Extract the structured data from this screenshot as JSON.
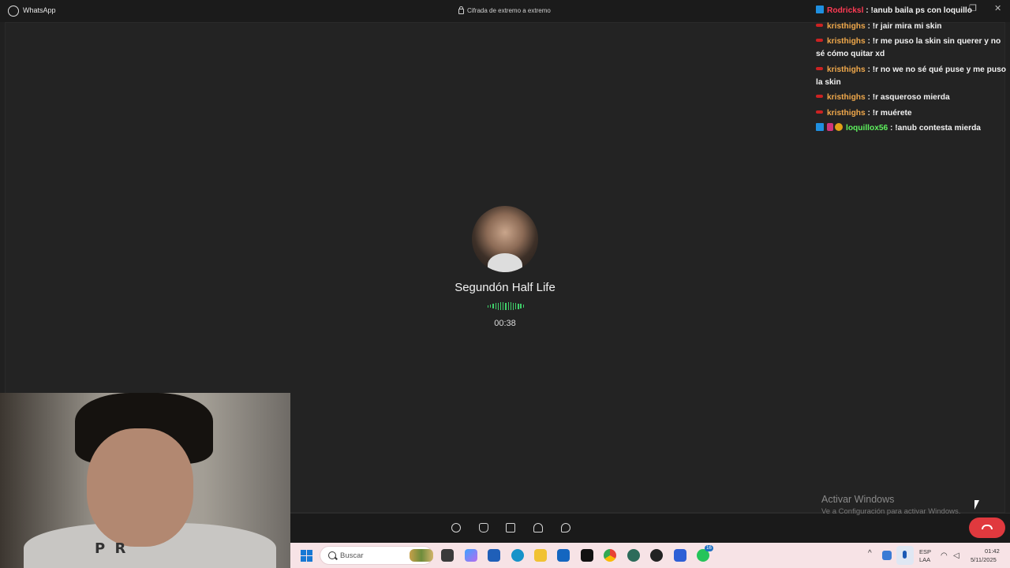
{
  "window": {
    "app_name": "WhatsApp",
    "encryption_label": "Cifrada de extremo a extremo"
  },
  "call": {
    "contact_name": "Segundón Half Life",
    "duration": "00:38"
  },
  "chat": [
    {
      "badges": [
        "blue"
      ],
      "user": "Rodricksl",
      "user_color": "#ff3b54",
      "text": ": !anub baila ps con loquillo"
    },
    {
      "badges": [
        "red"
      ],
      "user": "kristhighs",
      "user_color": "#f0a84b",
      "text": ": !r jair mira mi skin"
    },
    {
      "badges": [
        "red"
      ],
      "user": "kristhighs",
      "user_color": "#f0a84b",
      "text": ": !r me puso la skin sin querer y no sé cómo quitar xd"
    },
    {
      "badges": [
        "red"
      ],
      "user": "kristhighs",
      "user_color": "#f0a84b",
      "text": ": !r no we no sé qué puse y me puso la skin"
    },
    {
      "badges": [
        "red"
      ],
      "user": "kristhighs",
      "user_color": "#f0a84b",
      "text": ": !r asqueroso mierda"
    },
    {
      "badges": [
        "red"
      ],
      "user": "kristhighs",
      "user_color": "#f0a84b",
      "text": ": !r muérete"
    },
    {
      "badges": [
        "blue",
        "pink",
        "gold"
      ],
      "user": "loquillox56",
      "user_color": "#5ef25e",
      "text": ": !anub contesta mierda"
    }
  ],
  "webcam": {
    "shirt_text": "P R"
  },
  "watermark": {
    "title": "Activar Windows",
    "subtitle": "Ve a Configuración para activar Windows."
  },
  "taskbar": {
    "search_placeholder": "Buscar",
    "whatsapp_badge": "16",
    "language_line1": "ESP",
    "language_line2": "LAA",
    "time": "01:42",
    "date": "5/11/2025"
  },
  "colors": {
    "end_call": "#e0393e",
    "waveform": "#3fd06a",
    "taskbar_bg": "#f7e3e6"
  }
}
